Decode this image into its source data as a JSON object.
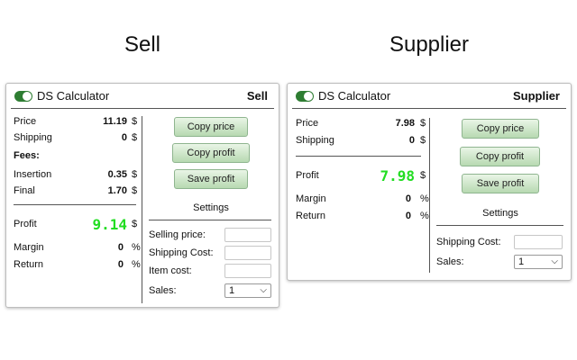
{
  "captions": {
    "sell": "Sell",
    "supplier": "Supplier"
  },
  "theme": {
    "accent": "#2e7d32",
    "profit_color": "#22dd22",
    "button_top": "#e9f5e6",
    "button_bottom": "#b7d9b1"
  },
  "sell": {
    "app_title": "DS Calculator",
    "mode": "Sell",
    "price": {
      "label": "Price",
      "value": "11.19",
      "unit": "$"
    },
    "shipping": {
      "label": "Shipping",
      "value": "0",
      "unit": "$"
    },
    "fees_label": "Fees:",
    "insertion": {
      "label": "Insertion",
      "value": "0.35",
      "unit": "$"
    },
    "final": {
      "label": "Final",
      "value": "1.70",
      "unit": "$"
    },
    "profit": {
      "label": "Profit",
      "value": "9.14",
      "unit": "$"
    },
    "margin": {
      "label": "Margin",
      "value": "0",
      "unit": "%"
    },
    "return": {
      "label": "Return",
      "value": "0",
      "unit": "%"
    },
    "buttons": {
      "copy_price": "Copy price",
      "copy_profit": "Copy profit",
      "save_profit": "Save profit"
    },
    "settings": {
      "title": "Settings",
      "selling_price_label": "Selling price:",
      "shipping_cost_label": "Shipping Cost:",
      "item_cost_label": "Item cost:",
      "sales_label": "Sales:",
      "sales_value": "1"
    }
  },
  "supplier": {
    "app_title": "DS Calculator",
    "mode": "Supplier",
    "price": {
      "label": "Price",
      "value": "7.98",
      "unit": "$"
    },
    "shipping": {
      "label": "Shipping",
      "value": "0",
      "unit": "$"
    },
    "profit": {
      "label": "Profit",
      "value": "7.98",
      "unit": "$"
    },
    "margin": {
      "label": "Margin",
      "value": "0",
      "unit": "%"
    },
    "return": {
      "label": "Return",
      "value": "0",
      "unit": "%"
    },
    "buttons": {
      "copy_price": "Copy price",
      "copy_profit": "Copy profit",
      "save_profit": "Save profit"
    },
    "settings": {
      "title": "Settings",
      "shipping_cost_label": "Shipping Cost:",
      "sales_label": "Sales:",
      "sales_value": "1"
    }
  }
}
